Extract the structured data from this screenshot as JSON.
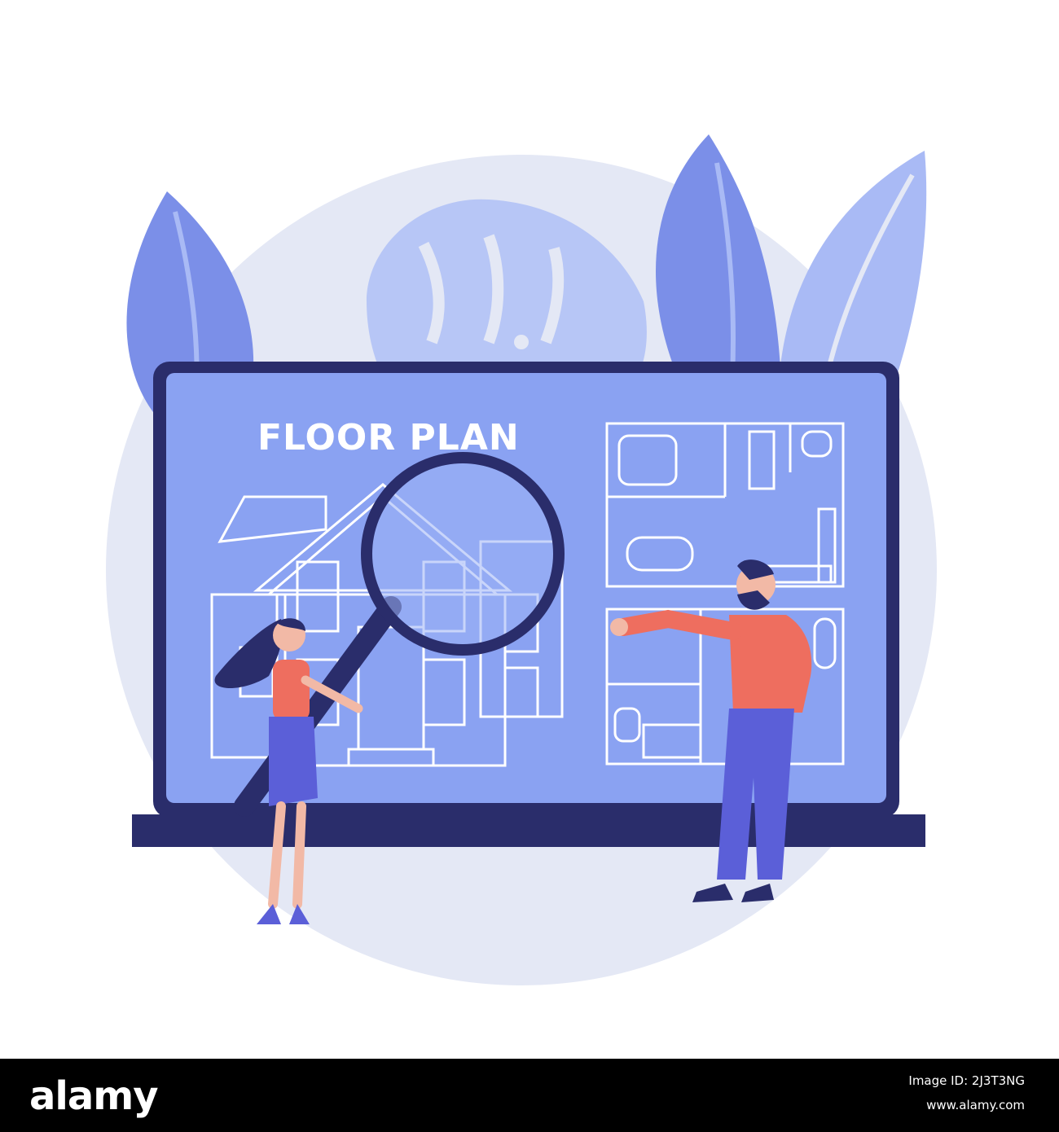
{
  "screen": {
    "title": "FLOOR PLAN"
  },
  "watermark": {
    "brand": "alamy",
    "image_id": "Image ID: 2J3T3NG",
    "url": "www.alamy.com"
  },
  "colors": {
    "primary_blue": "#7B8FE8",
    "light_blue": "#A9BAF5",
    "pale_circle": "#E4E8F5",
    "dark_navy": "#2A2D6B",
    "screen_fill": "#8AA2F2",
    "shirt_orange": "#EE6E5F",
    "pants_blue": "#5B5FD8",
    "skin": "#F2B9A6"
  },
  "icons": [
    "leaf",
    "monstera-leaf",
    "laptop",
    "house",
    "magnifying-glass",
    "floor-plan",
    "woman",
    "man"
  ]
}
